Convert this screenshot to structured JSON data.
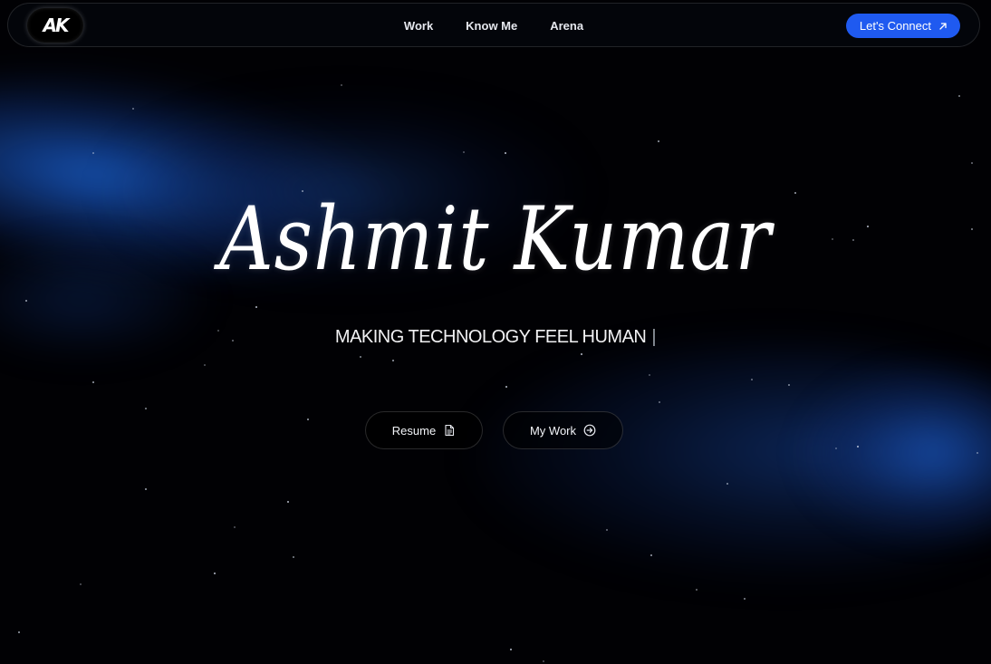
{
  "nav": {
    "logo_text": "AK",
    "links": [
      {
        "label": "Work"
      },
      {
        "label": "Know Me"
      },
      {
        "label": "Arena"
      }
    ],
    "cta_label": "Let's Connect",
    "cta_icon": "arrow-up-right-icon",
    "cta_color": "#1f5af0"
  },
  "hero": {
    "name": "Ashmit Kumar",
    "tagline": "MAKING TECHNOLOGY FEEL HUMAN",
    "cursor": "|",
    "buttons": [
      {
        "label": "Resume",
        "icon": "document-icon"
      },
      {
        "label": "My Work",
        "icon": "arrow-circle-right-icon"
      }
    ]
  },
  "theme": {
    "background": "#010104",
    "glow": "#1e6eeb"
  }
}
